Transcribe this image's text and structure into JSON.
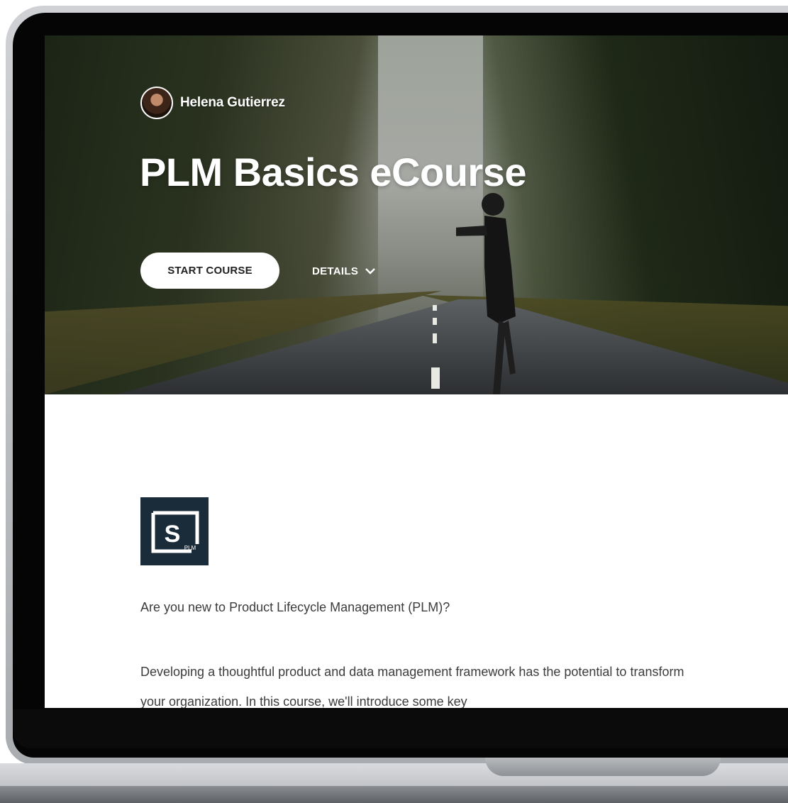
{
  "course": {
    "author_name": "Helena Gutierrez",
    "title": "PLM Basics eCourse",
    "start_label": "START COURSE",
    "details_label": "DETAILS"
  },
  "content": {
    "logo_letter": "S",
    "logo_sub": "PLM",
    "intro": "Are you new to Product Lifecycle Management (PLM)?",
    "description": "Developing a thoughtful product and data management framework has the potential to transform your organization. In this course, we'll introduce some key"
  },
  "icons": {
    "details_chevron": "chevron-down-icon",
    "avatar": "avatar"
  },
  "colors": {
    "logo_bg": "#1a2b3a",
    "button_bg": "#ffffff",
    "body_text": "#3c3c3c"
  }
}
